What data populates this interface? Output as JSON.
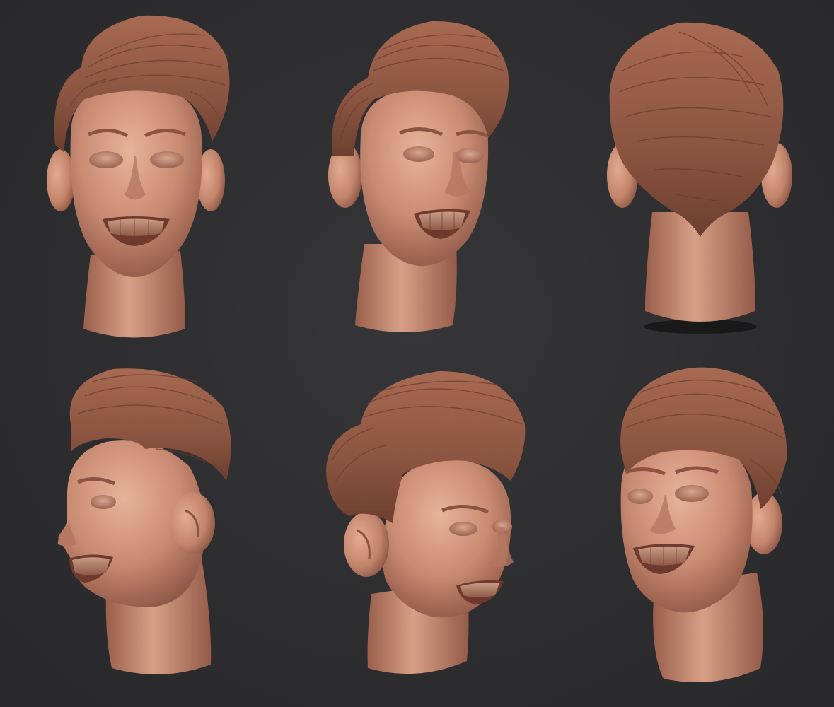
{
  "scene": {
    "background_color": "#2e2e30",
    "skin_color": "#c98b72",
    "hair_color": "#8a5440",
    "views": [
      {
        "view": "front",
        "icon": "head-front-icon"
      },
      {
        "view": "three-quarter-left",
        "icon": "head-three-quarter-icon"
      },
      {
        "view": "back",
        "icon": "head-back-icon"
      },
      {
        "view": "left-profile",
        "icon": "head-profile-icon"
      },
      {
        "view": "three-quarter-high",
        "icon": "head-three-quarter-icon"
      },
      {
        "view": "three-quarter-low",
        "icon": "head-three-quarter-icon"
      }
    ]
  }
}
